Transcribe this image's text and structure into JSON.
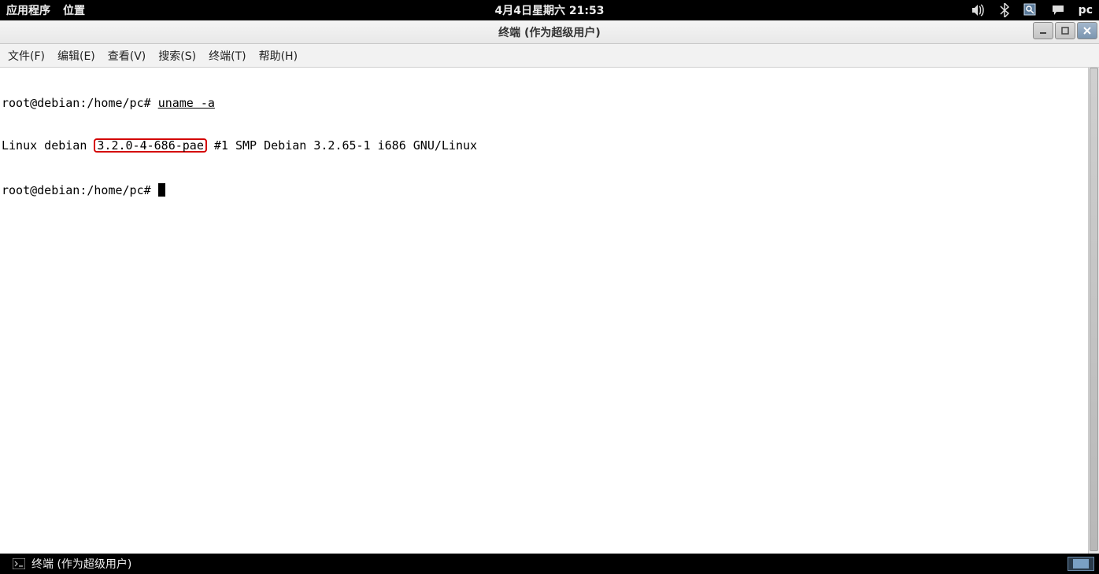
{
  "top_panel": {
    "apps": "应用程序",
    "places": "位置",
    "clock": "4月4日星期六 21:53",
    "user": "pc"
  },
  "window": {
    "title": "终端 (作为超级用户)"
  },
  "menubar": {
    "file": "文件(F)",
    "edit": "编辑(E)",
    "view": "查看(V)",
    "search": "搜索(S)",
    "terminal": "终端(T)",
    "help": "帮助(H)"
  },
  "terminal": {
    "line1_prompt": "root@debian:/home/pc# ",
    "line1_cmd": "uname -a",
    "line2_pre": "Linux debian ",
    "line2_hl": "3.2.0-4-686-pae",
    "line2_post": " #1 SMP Debian 3.2.65-1 i686 GNU/Linux",
    "line3_prompt": "root@debian:/home/pc# "
  },
  "taskbar": {
    "item": "终端 (作为超级用户)"
  }
}
